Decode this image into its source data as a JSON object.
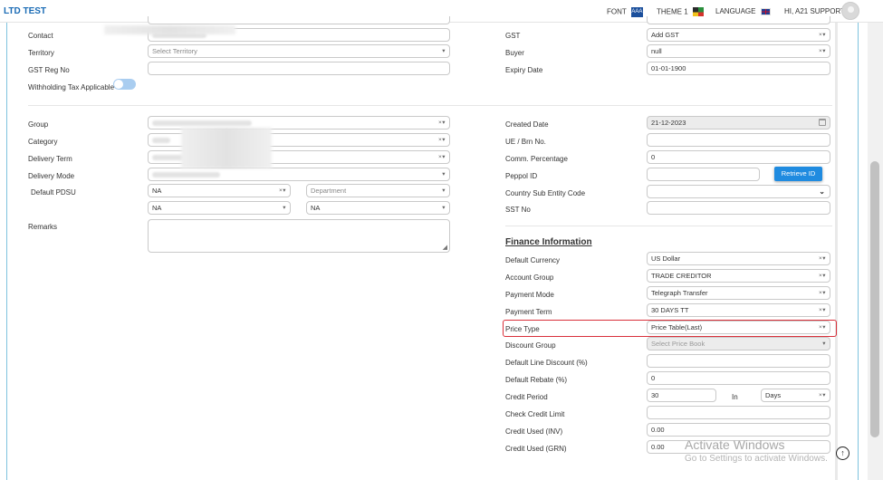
{
  "header": {
    "brand": "LTD TEST",
    "font_label": "FONT",
    "font_icon_text": "AAA",
    "theme_label": "THEME 1",
    "language_label": "LANGUAGE",
    "user_label": "HI, A21 SUPPORT"
  },
  "left": {
    "contact_label": "Contact",
    "territory_label": "Territory",
    "territory_placeholder": "Select Territory",
    "gst_reg_label": "GST Reg No",
    "withholding_label": "Withholding Tax Applicable",
    "group_label": "Group",
    "category_label": "Category",
    "delivery_term_label": "Delivery Term",
    "delivery_mode_label": "Delivery Mode",
    "default_pdsu_label": "Default PDSU",
    "pdsu_value_1": "NA",
    "department_placeholder": "Department",
    "pdsu_value_2": "NA",
    "pdsu_value_3": "NA",
    "remarks_label": "Remarks"
  },
  "right": {
    "gst_label": "GST",
    "gst_value": "Add GST",
    "buyer_label": "Buyer",
    "buyer_value": "null",
    "expiry_label": "Expiry Date",
    "expiry_value": "01-01-1900",
    "created_label": "Created Date",
    "created_value": "21-12-2023",
    "ue_label": "UE / Brn No.",
    "comm_label": "Comm. Percentage",
    "comm_value": "0",
    "peppol_label": "Peppol ID",
    "retrieve_label": "Retrieve ID",
    "country_sub_label": "Country Sub Entity Code",
    "sst_label": "SST No"
  },
  "finance": {
    "title": "Finance Information",
    "currency_label": "Default Currency",
    "currency_value": "US Dollar",
    "account_group_label": "Account Group",
    "account_group_value": "TRADE CREDITOR",
    "payment_mode_label": "Payment Mode",
    "payment_mode_value": "Telegraph Transfer",
    "payment_term_label": "Payment Term",
    "payment_term_value": "30 DAYS TT",
    "price_type_label": "Price Type",
    "price_type_value": "Price Table(Last)",
    "discount_group_label": "Discount Group",
    "discount_group_placeholder": "Select Price Book",
    "line_discount_label": "Default Line Discount (%)",
    "rebate_label": "Default Rebate (%)",
    "rebate_value": "0",
    "credit_period_label": "Credit Period",
    "credit_period_value": "30",
    "credit_period_in": "In",
    "credit_period_unit": "Days",
    "check_credit_label": "Check Credit Limit",
    "credit_inv_label": "Credit Used (INV)",
    "credit_inv_value": "0.00",
    "credit_grn_label": "Credit Used (GRN)",
    "credit_grn_value": "0.00"
  },
  "controls": {
    "clear_dropdown": "×▾",
    "dropdown": "▾",
    "chevron": "⌄",
    "resize": "◢",
    "scroll_top": "↑"
  },
  "watermark": {
    "line1": "Activate Windows",
    "line2": "Go to Settings to activate Windows."
  },
  "colors": {
    "brand": "#1a6bb5",
    "accent_button": "#1f8be0",
    "highlight": "#d9303a"
  }
}
